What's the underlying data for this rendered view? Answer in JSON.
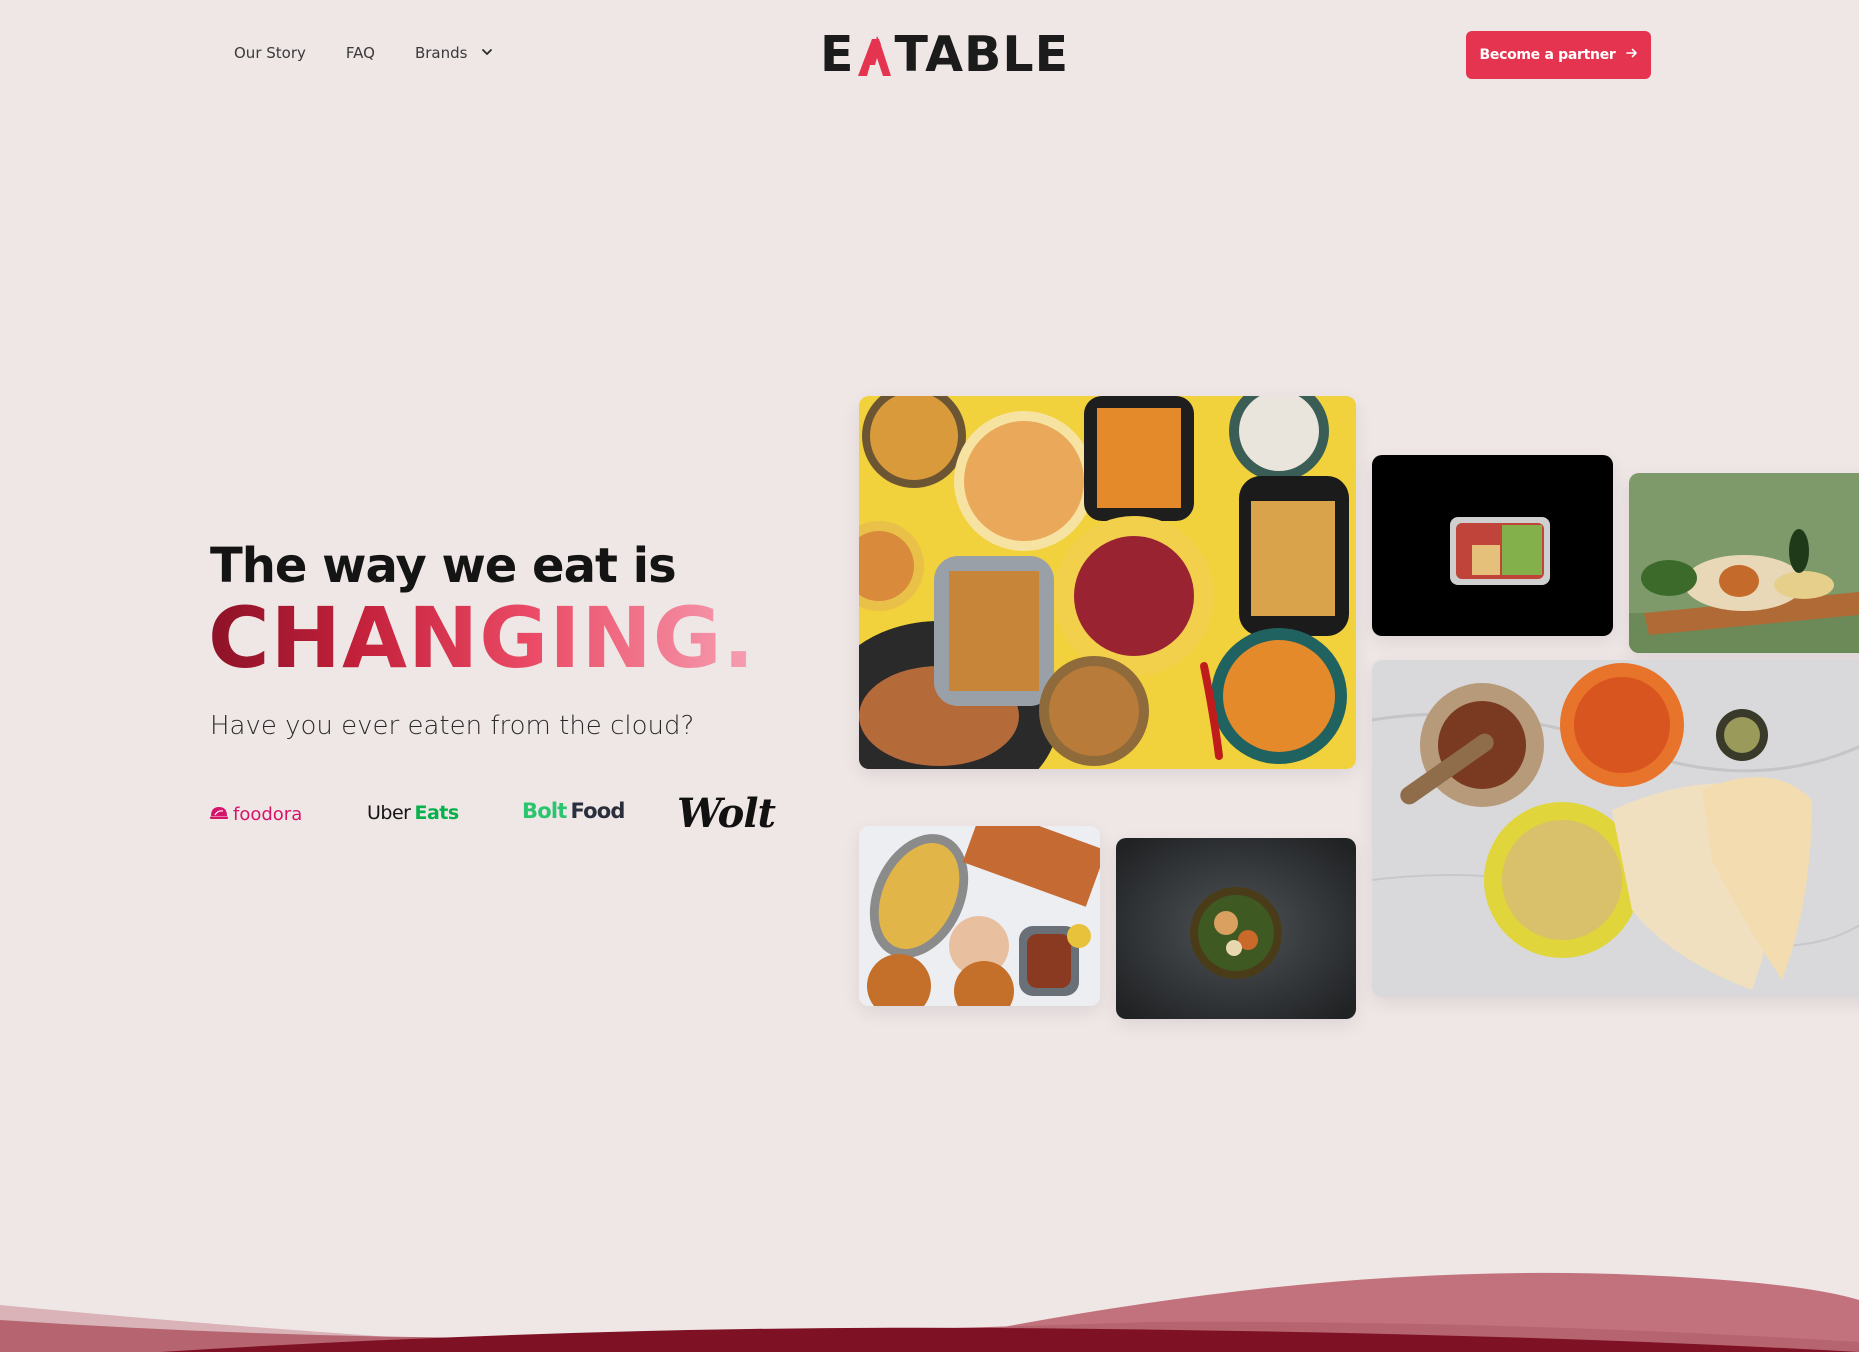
{
  "nav": {
    "links": [
      {
        "label": "Our Story"
      },
      {
        "label": "FAQ"
      }
    ],
    "brands_label": "Brands"
  },
  "logo": {
    "text_left": "E",
    "text_right": "TABLE",
    "accent": "#e5344f"
  },
  "cta": {
    "label": "Become a partner"
  },
  "hero": {
    "title_line1": "The way we eat is",
    "title_line2": "CHANGING.",
    "subtitle": "Have you ever eaten from the cloud?"
  },
  "partners": {
    "foodora": "foodora",
    "uber_part1": "Uber",
    "uber_part2": "Eats",
    "bolt_part1": "Bolt",
    "bolt_part2": "Food",
    "wolt": "Wolt"
  },
  "tiles": [
    {
      "name": "food-spread-yellow"
    },
    {
      "name": "bowl-on-black"
    },
    {
      "name": "burrito-on-board"
    },
    {
      "name": "curry-and-naan"
    },
    {
      "name": "burgers-and-fries"
    },
    {
      "name": "salad-bowl-dark"
    }
  ],
  "colors": {
    "background": "#efe6e6",
    "accent": "#e5344f",
    "wave_dark": "#7e1124",
    "wave_light": "#c2727c"
  }
}
